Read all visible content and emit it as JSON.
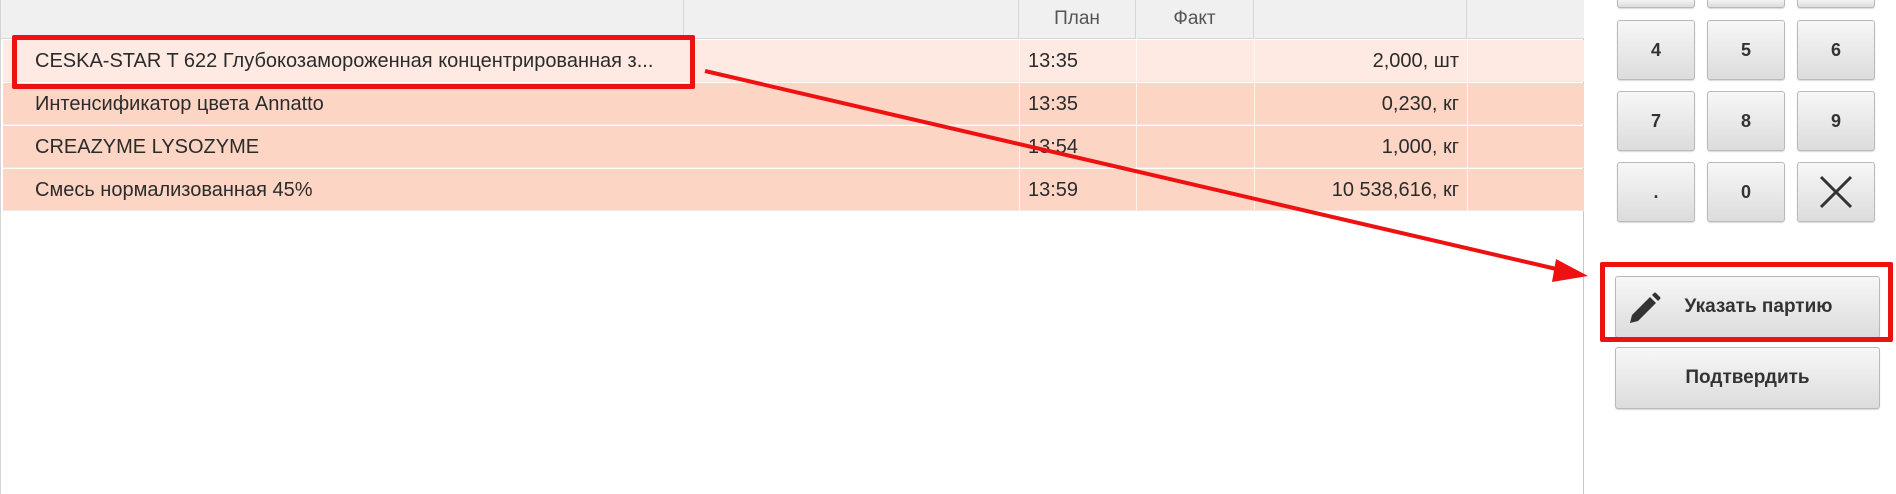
{
  "table": {
    "columns": {
      "name": "",
      "plan": "План",
      "fact": "Факт",
      "quantity": ""
    },
    "rows": [
      {
        "name": "CESKA-STAR T 622 Глубокозамороженная концентрированная з...",
        "plan": "13:35",
        "fact": "",
        "quantity": "2,000, шт",
        "selected": true
      },
      {
        "name": "Интенсификатор цвета Annatto",
        "plan": "13:35",
        "fact": "",
        "quantity": "0,230, кг",
        "selected": false
      },
      {
        "name": "CREAZYME LYSOZYME",
        "plan": "13:54",
        "fact": "",
        "quantity": "1,000, кг",
        "selected": false
      },
      {
        "name": "Смесь нормализованная 45%",
        "plan": "13:59",
        "fact": "",
        "quantity": "10 538,616, кг",
        "selected": false
      }
    ]
  },
  "keypad": {
    "keys": [
      "4",
      "5",
      "6",
      "7",
      "8",
      "9",
      ".",
      "0"
    ],
    "clear_icon": "close-icon"
  },
  "actions": {
    "specify_batch_label": "Указать партию",
    "specify_batch_icon": "pencil-icon",
    "confirm_label": "Подтвердить"
  },
  "colors": {
    "row_background": "#fdd5c4",
    "row_selected_background": "#feeae2",
    "annotation": "#ee1111"
  }
}
